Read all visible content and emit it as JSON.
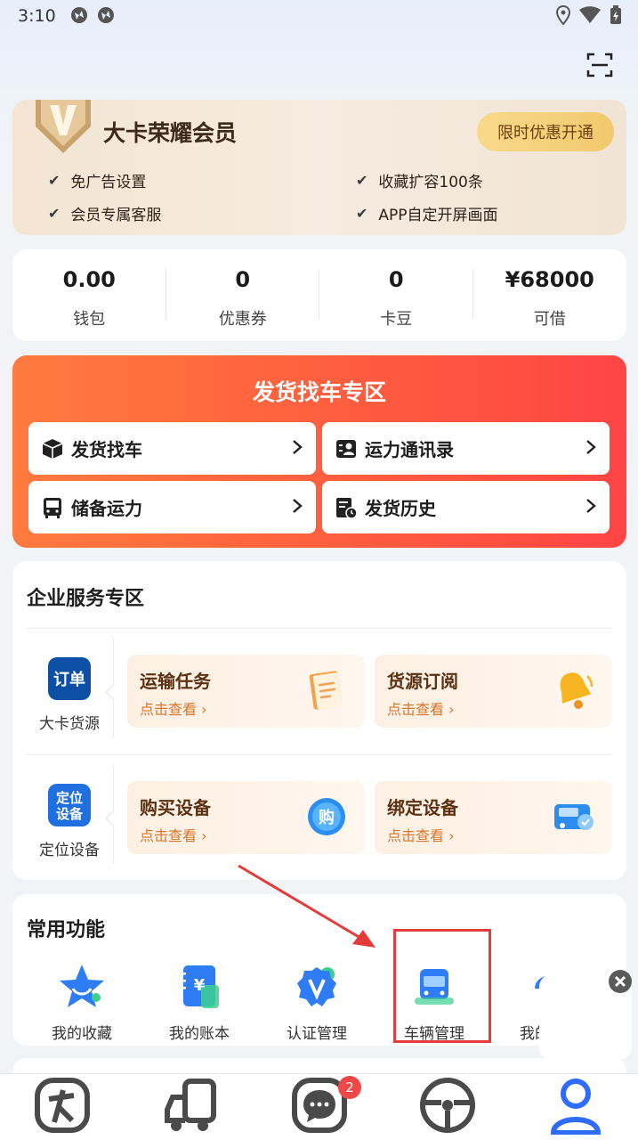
{
  "status_bar": {
    "time": "3:10"
  },
  "vip": {
    "title": "大卡荣耀会员",
    "open_button": "限时优惠开通",
    "benefits": [
      "免广告设置",
      "收藏扩容100条",
      "会员专属客服",
      "APP自定开屏画面"
    ]
  },
  "stats": [
    {
      "value": "0.00",
      "label": "钱包"
    },
    {
      "value": "0",
      "label": "优惠券"
    },
    {
      "value": "0",
      "label": "卡豆"
    },
    {
      "value": "¥68000",
      "label": "可借"
    }
  ],
  "shipping": {
    "title": "发货找车专区",
    "items": [
      "发货找车",
      "运力通讯录",
      "储备运力",
      "发货历史"
    ]
  },
  "enterprise": {
    "title": "企业服务专区",
    "groups": [
      {
        "badge": "订单",
        "label": "大卡货源",
        "tiles": [
          {
            "title": "运输任务",
            "sub": "点击查看"
          },
          {
            "title": "货源订阅",
            "sub": "点击查看"
          }
        ]
      },
      {
        "badge": "定位设备",
        "label": "定位设备",
        "tiles": [
          {
            "title": "购买设备",
            "sub": "点击查看"
          },
          {
            "title": "绑定设备",
            "sub": "点击查看"
          }
        ]
      }
    ]
  },
  "functions": {
    "title": "常用功能",
    "items": [
      "我的收藏",
      "我的账本",
      "认证管理",
      "车辆管理",
      "我的"
    ]
  },
  "tabbar": {
    "badge_count": "2",
    "colors": {
      "accent": "#2f6bff",
      "icon": "#4a4a4a"
    }
  }
}
